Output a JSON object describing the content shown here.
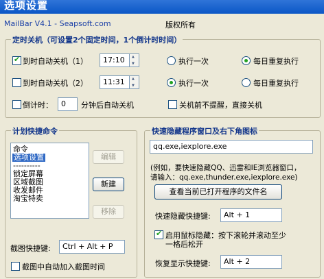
{
  "window": {
    "title": "选项设置"
  },
  "header": {
    "app_version": "MailBar V4.1 - Seapsoft.com",
    "copyright": "版权所有"
  },
  "shutdown": {
    "legend": "定时关机（可设置2个固定时间，1个倒计时时间）",
    "timer1": {
      "label": "到时自动关机（1）",
      "checked": true,
      "time": "17:10",
      "once_label": "执行一次",
      "daily_label": "每日重复执行",
      "mode": "daily"
    },
    "timer2": {
      "label": "到时自动关机（2）",
      "checked": false,
      "time": "11:31",
      "once_label": "执行一次",
      "daily_label": "每日重复执行",
      "mode": "once"
    },
    "countdown": {
      "label": "倒计时：",
      "value": "0",
      "suffix": "分钟后自动关机",
      "checked": false
    },
    "no_prompt": {
      "label": "关机前不提醒，直接关机",
      "checked": false
    }
  },
  "shortcuts": {
    "legend": "计划快捷命令",
    "items": [
      "命令",
      "选项设置",
      "----------",
      "锁定屏幕",
      "区域截图",
      "收发邮件",
      "淘宝特卖"
    ],
    "selected_index": 1,
    "edit_button": "编辑",
    "new_button": "新建",
    "remove_button": "移除",
    "hotkey_label": "截图快捷键:",
    "hotkey_value": "Ctrl + Alt + P",
    "auto_add": {
      "label": "截图中自动加入截图时间",
      "checked": false
    }
  },
  "hide": {
    "legend": "快速隐藏程序窗口及右下角图标",
    "programs": "qq.exe,iexplore.exe",
    "hint_line1": "(例如，要快速隐藏QQ、迅雷和IE浏览器窗口，",
    "hint_line2": "请输入：qq.exe,thunder.exe,iexplore.exe)",
    "view_button": "查看当前已打开程序的文件名",
    "hide_hotkey_label": "快速隐藏快捷键:",
    "hide_hotkey_value": "Alt + 1",
    "mouse_hide": {
      "line1": "启用鼠标隐藏：按下滚轮并滚动至少",
      "line2": "一格后松开",
      "checked": true
    },
    "restore_hotkey_label": "恢复显示快捷键:",
    "restore_hotkey_value": "Alt + 2"
  },
  "colors": {
    "title_bar": "#0b57c6",
    "client_bg": "#ece9d8",
    "legend_text": "#10348a",
    "check_mark": "#21a121",
    "selection": "#316ac5"
  }
}
